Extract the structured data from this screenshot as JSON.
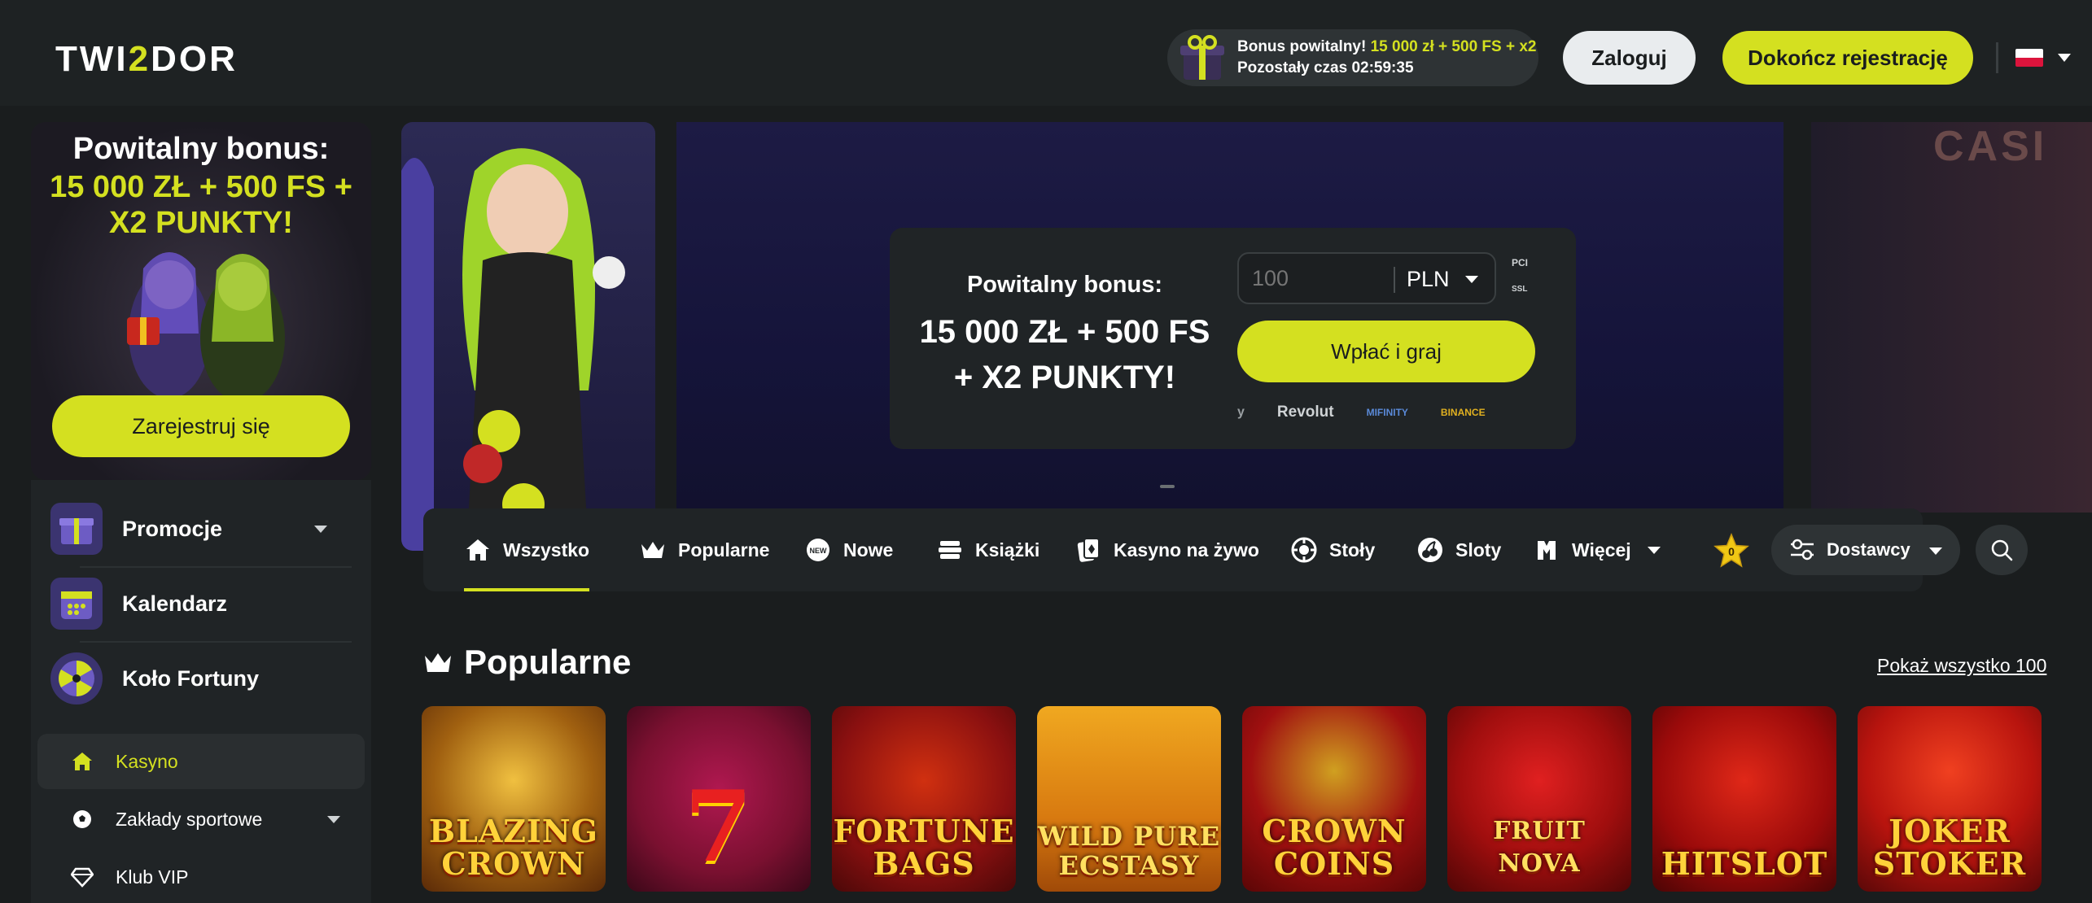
{
  "header": {
    "logo_left": "TWI",
    "logo_mid": "2",
    "logo_right": "DOR",
    "bonus_label": "Bonus powitalny!",
    "bonus_value": "15 000 zł + 500 FS + x2",
    "bonus_timer": "Pozostały czas 02:59:35",
    "login_label": "Zaloguj",
    "finish_label": "Dokończ rejestrację",
    "language_flag": "PL"
  },
  "sidebar": {
    "promo_title": "Powitalny bonus:",
    "promo_line1": "15 000 ZŁ + 500 FS +",
    "promo_line2": "X2 PUNKTY!",
    "register_label": "Zarejestruj się",
    "big_items": [
      {
        "label": "Promocje",
        "icon": "gift-box-icon",
        "has_dropdown": true
      },
      {
        "label": "Kalendarz",
        "icon": "calendar-icon",
        "has_dropdown": false
      },
      {
        "label": "Koło Fortuny",
        "icon": "fortune-wheel-icon",
        "has_dropdown": false
      }
    ],
    "nav_items": [
      {
        "label": "Kasyno",
        "icon": "home-icon",
        "active": true
      },
      {
        "label": "Zakłady sportowe",
        "icon": "soccer-ball-icon",
        "active": false,
        "has_dropdown": true
      },
      {
        "label": "Klub VIP",
        "icon": "diamond-icon",
        "active": false
      }
    ]
  },
  "hero": {
    "title": "Powitalny bonus:",
    "big_line1": "15 000 ZŁ + 500 FS",
    "big_line2": "+ X2 PUNKTY!",
    "amount_placeholder": "100",
    "currency": "PLN",
    "badge_pci": "PCI",
    "badge_ssl": "SSL",
    "deposit_label": "Wpłać i graj",
    "payments": [
      "y",
      "Revolut",
      "MIFINITY",
      "BINANCE"
    ],
    "right_sign": "CASI"
  },
  "categories": {
    "items": [
      {
        "label": "Wszystko",
        "icon": "home-icon",
        "active": true
      },
      {
        "label": "Popularne",
        "icon": "crown-icon",
        "active": false
      },
      {
        "label": "Nowe",
        "icon": "new-badge-icon",
        "active": false
      },
      {
        "label": "Książki",
        "icon": "books-icon",
        "active": false
      },
      {
        "label": "Kasyno na żywo",
        "icon": "cards-icon",
        "active": false
      },
      {
        "label": "Stoły",
        "icon": "chip-icon",
        "active": false
      },
      {
        "label": "Sloty",
        "icon": "slot-cherry-icon",
        "active": false
      },
      {
        "label": "Więcej",
        "icon": "more-icon",
        "active": false,
        "has_dropdown": true
      }
    ],
    "favorites_count": "0",
    "providers_label": "Dostawcy"
  },
  "popular": {
    "title": "Popularne",
    "show_all": "Pokaż wszystko 100",
    "games": [
      {
        "name": "BLAZING CROWN",
        "bg": "#b8860b"
      },
      {
        "name": "7",
        "bg": "#7a1030"
      },
      {
        "name": "FORTUNE BAGS",
        "bg": "#8a1010"
      },
      {
        "name": "WILD PURE ECSTASY",
        "bg": "#d87a10"
      },
      {
        "name": "CROWN COINS",
        "bg": "#8a0a0a"
      },
      {
        "name": "FRUIT NOVA",
        "bg": "#a00e0e"
      },
      {
        "name": "HITSLOT",
        "bg": "#9a0a0a"
      },
      {
        "name": "JOKER STOKER",
        "bg": "#b8140e"
      }
    ]
  },
  "colors": {
    "accent": "#d4e020",
    "bg": "#1a1d1e",
    "panel": "#202426"
  }
}
